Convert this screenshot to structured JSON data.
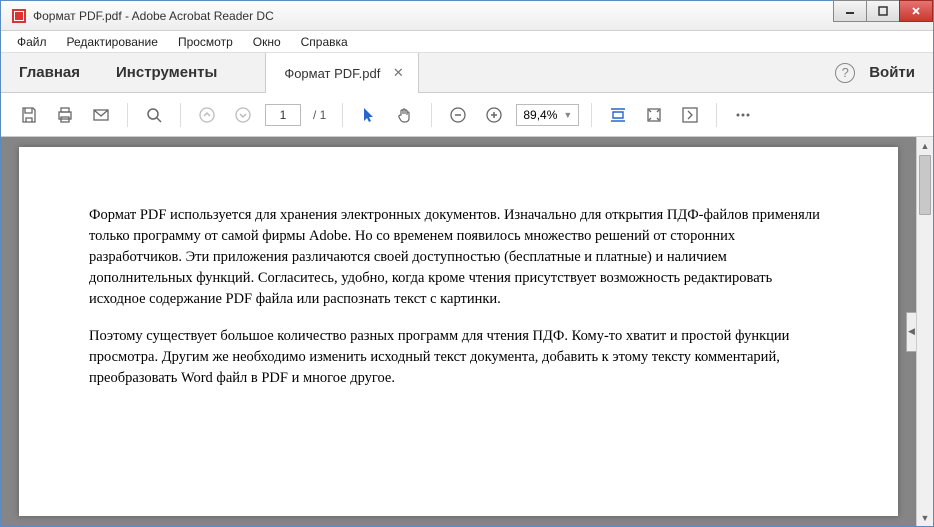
{
  "title": "Формат PDF.pdf - Adobe Acrobat Reader DC",
  "menu": {
    "file": "Файл",
    "edit": "Редактирование",
    "view": "Просмотр",
    "window": "Окно",
    "help": "Справка"
  },
  "tabs": {
    "home": "Главная",
    "tools": "Инструменты",
    "doc": "Формат PDF.pdf",
    "login": "Войти",
    "help": "?"
  },
  "toolbar": {
    "page_current": "1",
    "page_total": "/ 1",
    "zoom": "89,4%"
  },
  "document": {
    "p1": "Формат PDF используется для хранения электронных документов. Изначально для открытия ПДФ-файлов применяли только программу от самой фирмы Adobe. Но со временем появилось множество решений от сторонних разработчиков. Эти приложения различаются своей доступностью (бесплатные и платные) и наличием дополнительных функций. Согласитесь, удобно, когда кроме чтения присутствует возможность редактировать исходное содержание PDF файла или распознать текст с картинки.",
    "p2": "Поэтому существует большое количество разных программ для чтения ПДФ. Кому-то хватит и простой функции просмотра. Другим же необходимо изменить исходный текст документа, добавить к этому тексту комментарий, преобразовать Word файл в PDF и многое другое."
  }
}
